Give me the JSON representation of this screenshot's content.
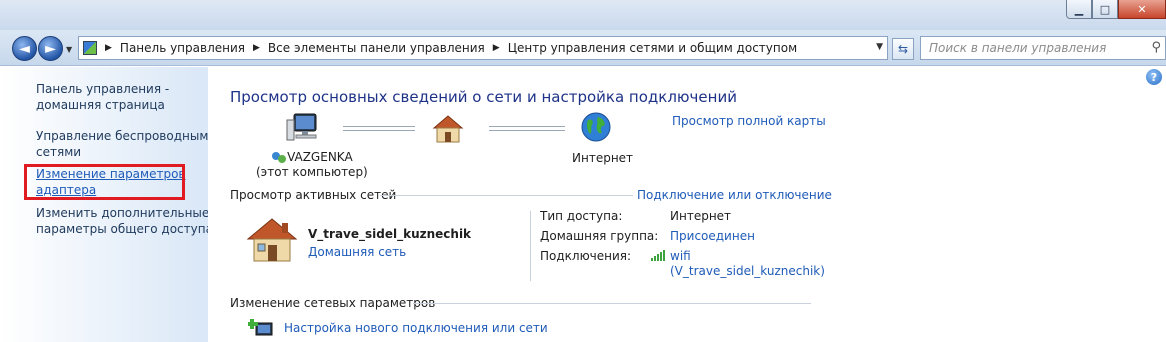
{
  "window": {
    "minimize_glyph": "▁",
    "maximize_glyph": "□",
    "close_glyph": "✕"
  },
  "nav": {
    "breadcrumbs": [
      "Панель управления",
      "Все элементы панели управления",
      "Центр управления сетями и общим доступом"
    ],
    "search_placeholder": "Поиск в панели управления",
    "back_glyph": "◄",
    "forward_glyph": "►"
  },
  "sidebar": {
    "items": [
      {
        "label_line1": "Панель управления -",
        "label_line2": "домашняя страница"
      },
      {
        "label_line1": "Управление беспроводными",
        "label_line2": "сетями"
      },
      {
        "label_line1": "Изменение параметров",
        "label_line2": "адаптера"
      },
      {
        "label_line1": "Изменить дополнительные",
        "label_line2": "параметры общего доступа"
      }
    ]
  },
  "main": {
    "help_glyph": "?",
    "title": "Просмотр основных сведений о сети и настройка подключений",
    "full_map_link": "Просмотр полной карты",
    "computer_name": "VAZGENKA",
    "computer_sub": "(этот компьютер)",
    "internet_label": "Интернет",
    "active_networks_header": "Просмотр активных сетей",
    "connect_disconnect_link": "Подключение или отключение",
    "network_name": "V_trave_sidel_kuznechik",
    "network_type_link": "Домашняя сеть",
    "access_type_label": "Тип доступа:",
    "access_type_value": "Интернет",
    "homegroup_label": "Домашняя группа:",
    "homegroup_value": "Присоединен",
    "connections_label": "Подключения:",
    "connection_value_line1": "wifi",
    "connection_value_line2": "(V_trave_sidel_kuznechik)",
    "change_settings_header": "Изменение сетевых параметров",
    "new_connection_link": "Настройка нового подключения или сети"
  },
  "colors": {
    "link": "#1f5bb8",
    "title": "#1e3287",
    "highlight_box": "#e11b22"
  },
  "icons": {
    "computer": "computer-icon",
    "house": "house-icon",
    "globe": "globe-icon",
    "wifi": "wifi-signal-icon",
    "new_connection": "new-connection-icon"
  }
}
